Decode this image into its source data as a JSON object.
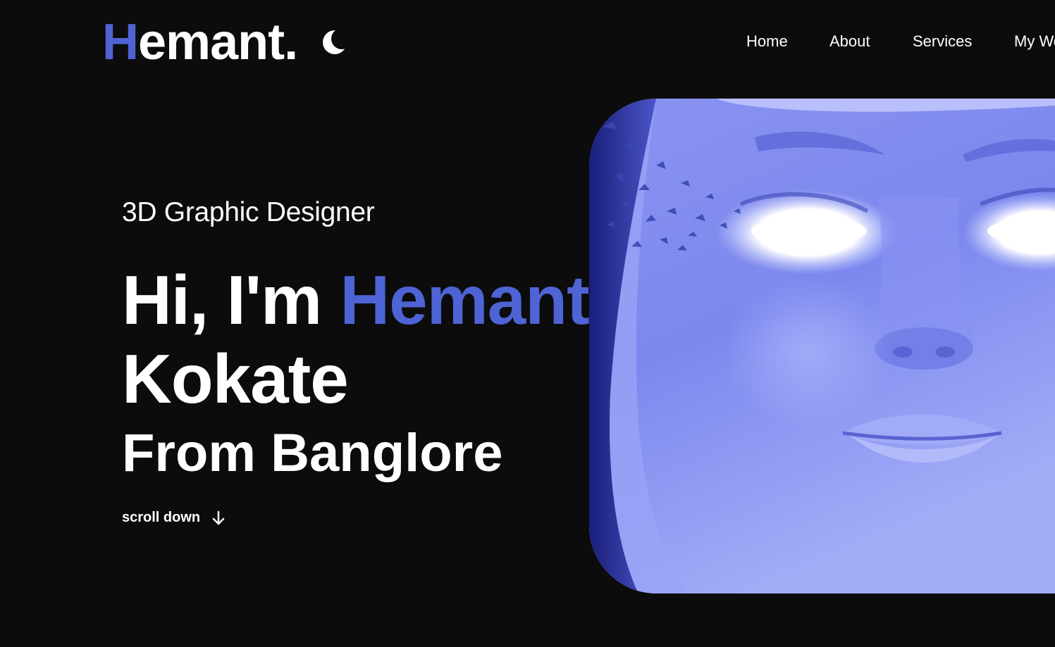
{
  "header": {
    "logo": {
      "first_letter": "H",
      "rest": "emant."
    },
    "theme_toggle_icon": "moon-icon",
    "nav": [
      {
        "label": "Home"
      },
      {
        "label": "About"
      },
      {
        "label": "Services"
      },
      {
        "label": "My Wo"
      }
    ]
  },
  "hero": {
    "subtitle": "3D Graphic Designer",
    "headline_prefix": "Hi, I'm ",
    "headline_name": "Hemant",
    "headline_surname": "Kokate",
    "headline_location": "From Banglore",
    "scroll_label": "scroll down",
    "scroll_icon": "arrow-down-icon",
    "image": "glowing-face-3d-render"
  },
  "colors": {
    "background": "#0c0c0d",
    "accent": "#4e63d4",
    "text": "#ffffff",
    "image_tone": "#7a86ea"
  }
}
